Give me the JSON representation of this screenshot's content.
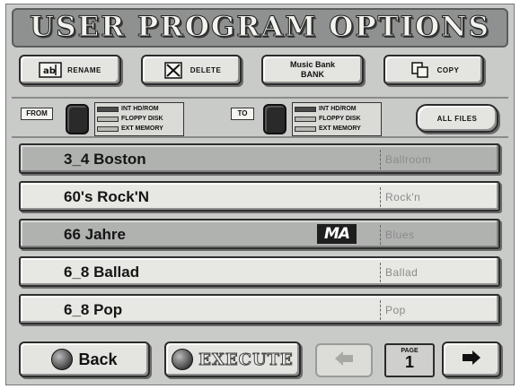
{
  "header": {
    "title": "USER PROGRAM OPTIONS"
  },
  "operations": {
    "rename_label": "RENAME",
    "delete_label": "DELETE",
    "music_bank_line1": "Music Bank",
    "music_bank_line2": "BANK",
    "copy_label": "COPY"
  },
  "source": {
    "from_label": "FROM",
    "to_label": "TO",
    "media": [
      "INT HD/ROM",
      "FLOPPY DISK",
      "EXT MEMORY"
    ],
    "all_files_label": "ALL FILES"
  },
  "programs": [
    {
      "name": "3_4 Boston",
      "style": "Ballroom",
      "selected": true,
      "badge": ""
    },
    {
      "name": "60's Rock'N",
      "style": "Rock'n",
      "selected": false,
      "badge": ""
    },
    {
      "name": "66 Jahre",
      "style": "Blues",
      "selected": true,
      "badge": "MA"
    },
    {
      "name": "6_8 Ballad",
      "style": "Ballad",
      "selected": false,
      "badge": ""
    },
    {
      "name": "6_8 Pop",
      "style": "Pop",
      "selected": false,
      "badge": ""
    }
  ],
  "footer": {
    "back_label": "Back",
    "execute_label": "EXECUTE",
    "page_label": "PAGE",
    "page_number": "1"
  },
  "colors": {
    "screen_bg": "#c9cbc9",
    "title_bg": "#8f9190",
    "selected_row": "#b0b2b0"
  },
  "icons": {
    "prev": "arrow-left-icon",
    "next": "arrow-right-icon",
    "back": "back-ball-icon",
    "execute": "execute-ball-icon"
  }
}
